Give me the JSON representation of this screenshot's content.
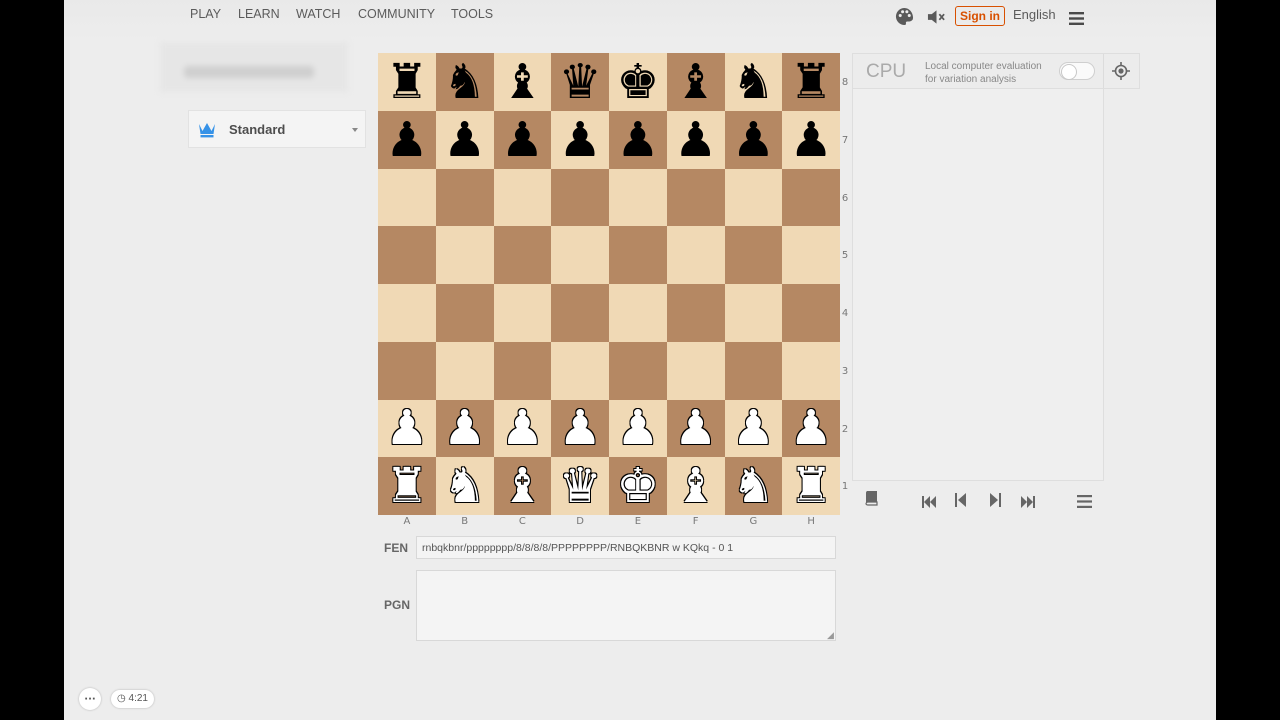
{
  "nav": {
    "links": [
      "PLAY",
      "LEARN",
      "WATCH",
      "COMMUNITY",
      "TOOLS"
    ],
    "sign_in": "Sign in",
    "language": "English"
  },
  "sidebar": {
    "variant": "Standard"
  },
  "board": {
    "rows": [
      [
        "bR",
        "bN",
        "bB",
        "bQ",
        "bK",
        "bB",
        "bN",
        "bR"
      ],
      [
        "bP",
        "bP",
        "bP",
        "bP",
        "bP",
        "bP",
        "bP",
        "bP"
      ],
      [
        "",
        "",
        "",
        "",
        "",
        "",
        "",
        ""
      ],
      [
        "",
        "",
        "",
        "",
        "",
        "",
        "",
        ""
      ],
      [
        "",
        "",
        "",
        "",
        "",
        "",
        "",
        ""
      ],
      [
        "",
        "",
        "",
        "",
        "",
        "",
        "",
        ""
      ],
      [
        "wP",
        "wP",
        "wP",
        "wP",
        "wP",
        "wP",
        "wP",
        "wP"
      ],
      [
        "wR",
        "wN",
        "wB",
        "wQ",
        "wK",
        "wB",
        "wN",
        "wR"
      ]
    ],
    "ranks": [
      "8",
      "7",
      "6",
      "5",
      "4",
      "3",
      "2",
      "1"
    ],
    "files": [
      "A",
      "B",
      "C",
      "D",
      "E",
      "F",
      "G",
      "H"
    ],
    "light_color": "#f0d9b5",
    "dark_color": "#b58863"
  },
  "fen": {
    "label": "FEN",
    "value": "rnbqkbnr/pppppppp/8/8/8/8/PPPPPPPP/RNBQKBNR w KQkq - 0 1"
  },
  "pgn": {
    "label": "PGN",
    "value": ""
  },
  "ceval": {
    "label": "CPU",
    "description_line1": "Local computer evaluation",
    "description_line2": "for variation analysis",
    "enabled": false
  },
  "controls": {
    "icons": [
      "book-icon",
      "first-move-icon",
      "prev-move-icon",
      "next-move-icon",
      "last-move-icon",
      "menu-icon"
    ]
  },
  "video": {
    "more_label": "···",
    "time": "4:21"
  },
  "colors": {
    "accent": "#d85000",
    "variant_icon": "#3692e7"
  }
}
